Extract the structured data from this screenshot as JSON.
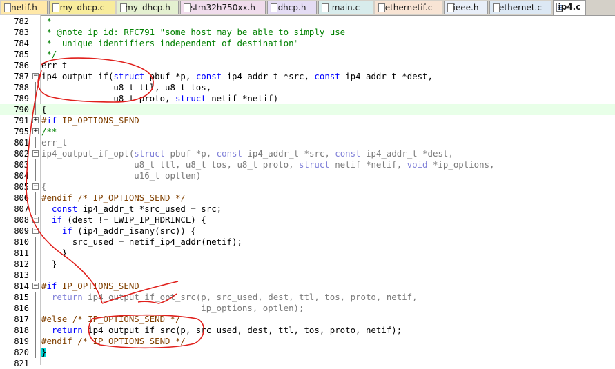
{
  "tabs": [
    {
      "label": "netif.h",
      "color": "#ffe8a8",
      "active": false
    },
    {
      "label": "my_dhcp.c",
      "color": "#f8ec9c",
      "active": false
    },
    {
      "label": "my_dhcp.h",
      "color": "#e4f0d0",
      "active": false
    },
    {
      "label": "stm32h750xx.h",
      "color": "#f0dcec",
      "active": false
    },
    {
      "label": "dhcp.h",
      "color": "#e4dcf4",
      "active": false
    },
    {
      "label": "main.c",
      "color": "#d8ecec",
      "active": false
    },
    {
      "label": "ethernetif.c",
      "color": "#f8e4d4",
      "active": false
    },
    {
      "label": "ieee.h",
      "color": "#e8eef8",
      "active": false
    },
    {
      "label": "ethernet.c",
      "color": "#dce8f4",
      "active": false
    },
    {
      "label": "ip4.c",
      "color": "#ffffff",
      "active": true
    }
  ],
  "code_lines": [
    {
      "num": "782",
      "text": " *",
      "style": "com"
    },
    {
      "num": "783",
      "text": " * @note ip_id: RFC791 \"some host may be able to simply use",
      "style": "com"
    },
    {
      "num": "784",
      "text": " *  unique identifiers independent of destination\"",
      "style": "com"
    },
    {
      "num": "785",
      "text": " */",
      "style": "com"
    },
    {
      "num": "786",
      "text": "err_t",
      "style": "code"
    },
    {
      "num": "787",
      "text": "ip4_output_if(struct pbuf *p, const ip4_addr_t *src, const ip4_addr_t *dest,",
      "style": "code",
      "fold": "minus"
    },
    {
      "num": "788",
      "text": "              u8_t ttl, u8_t tos,",
      "style": "code"
    },
    {
      "num": "789",
      "text": "              u8_t proto, struct netif *netif)",
      "style": "code"
    },
    {
      "num": "790",
      "text": "{",
      "style": "code",
      "highlight": true
    },
    {
      "num": "791",
      "text": "#if IP_OPTIONS_SEND",
      "style": "pre",
      "fold": "plus",
      "separator": true
    },
    {
      "num": "795",
      "text": "/**",
      "style": "com",
      "fold": "plus"
    },
    {
      "num": "801",
      "text": "err_t",
      "style": "dim"
    },
    {
      "num": "802",
      "text": "ip4_output_if_opt(struct pbuf *p, const ip4_addr_t *src, const ip4_addr_t *dest,",
      "style": "dim",
      "fold": "minus"
    },
    {
      "num": "803",
      "text": "                  u8_t ttl, u8_t tos, u8_t proto, struct netif *netif, void *ip_options,",
      "style": "dim"
    },
    {
      "num": "804",
      "text": "                  u16_t optlen)",
      "style": "dim"
    },
    {
      "num": "805",
      "text": "{",
      "style": "dim",
      "fold": "minus"
    },
    {
      "num": "806",
      "text": "#endif /* IP_OPTIONS_SEND */",
      "style": "pre"
    },
    {
      "num": "807",
      "text": "  const ip4_addr_t *src_used = src;",
      "style": "code"
    },
    {
      "num": "808",
      "text": "  if (dest != LWIP_IP_HDRINCL) {",
      "style": "code",
      "fold": "minus"
    },
    {
      "num": "809",
      "text": "    if (ip4_addr_isany(src)) {",
      "style": "code",
      "fold": "minus"
    },
    {
      "num": "810",
      "text": "      src_used = netif_ip4_addr(netif);",
      "style": "code"
    },
    {
      "num": "811",
      "text": "    }",
      "style": "code"
    },
    {
      "num": "812",
      "text": "  }",
      "style": "code"
    },
    {
      "num": "813",
      "text": "",
      "style": "code"
    },
    {
      "num": "814",
      "text": "#if IP_OPTIONS_SEND",
      "style": "pre",
      "fold": "minus"
    },
    {
      "num": "815",
      "text": "  return ip4_output_if_opt_src(p, src_used, dest, ttl, tos, proto, netif,",
      "style": "dim"
    },
    {
      "num": "816",
      "text": "                               ip_options, optlen);",
      "style": "dim"
    },
    {
      "num": "817",
      "text": "#else /* IP_OPTIONS_SEND */",
      "style": "pre"
    },
    {
      "num": "818",
      "text": "  return ip4_output_if_src(p, src_used, dest, ttl, tos, proto, netif);",
      "style": "code"
    },
    {
      "num": "819",
      "text": "#endif /* IP_OPTIONS_SEND */",
      "style": "pre"
    },
    {
      "num": "820",
      "text": "}",
      "style": "code",
      "cursor": true
    },
    {
      "num": "821",
      "text": "",
      "style": "code"
    }
  ],
  "annotation_color": "#e0201c"
}
